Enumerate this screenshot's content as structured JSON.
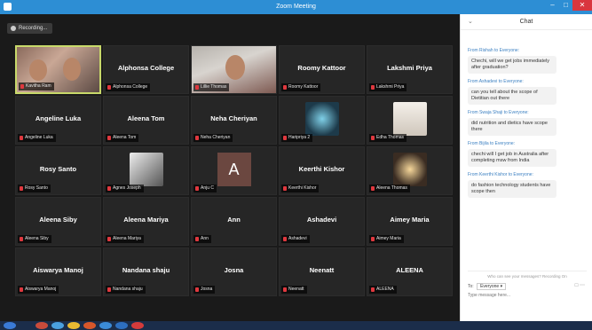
{
  "window": {
    "title": "Zoom Meeting"
  },
  "recording": {
    "label": "Recording..."
  },
  "participants": [
    {
      "name": "Kavitha Ram",
      "display": "",
      "type": "video"
    },
    {
      "name": "Alphonsa College",
      "display": "Alphonsa College",
      "type": "name"
    },
    {
      "name": "Lillie Thomas",
      "display": "",
      "type": "video"
    },
    {
      "name": "Roomy Kattoor",
      "display": "Roomy Kattoor",
      "type": "name"
    },
    {
      "name": "Lakshmi Priya",
      "display": "Lakshmi Priya",
      "type": "name"
    },
    {
      "name": "Angeline Luka",
      "display": "Angeline Luka",
      "type": "name"
    },
    {
      "name": "Aleena Tom",
      "display": "Aleena Tom",
      "type": "name"
    },
    {
      "name": "Neha Cheriyan",
      "display": "Neha Cheriyan",
      "type": "name"
    },
    {
      "name": "Haripriya 2",
      "display": "",
      "type": "image"
    },
    {
      "name": "Edha Thomas",
      "display": "",
      "type": "image"
    },
    {
      "name": "Rosy Santo",
      "display": "Rosy Santo",
      "type": "name"
    },
    {
      "name": "Agnes Joseph",
      "display": "",
      "type": "image"
    },
    {
      "name": "Anju C",
      "display": "A",
      "type": "avatar"
    },
    {
      "name": "Keerthi Kishor",
      "display": "Keerthi Kishor",
      "type": "name"
    },
    {
      "name": "Aleena Thomas",
      "display": "",
      "type": "image"
    },
    {
      "name": "Aleena Siby",
      "display": "Aleena Siby",
      "type": "name"
    },
    {
      "name": "Aleena Mariya",
      "display": "Aleena Mariya",
      "type": "name"
    },
    {
      "name": "Ann",
      "display": "Ann",
      "type": "name"
    },
    {
      "name": "Ashadevi",
      "display": "Ashadevi",
      "type": "name"
    },
    {
      "name": "Aimey Maria",
      "display": "Aimey Maria",
      "type": "name"
    },
    {
      "name": "Aiswarya Manoj",
      "display": "Aiswarya Manoj",
      "type": "name"
    },
    {
      "name": "Nandana shaju",
      "display": "Nandana shaju",
      "type": "name"
    },
    {
      "name": "Josna",
      "display": "Josna",
      "type": "name"
    },
    {
      "name": "Neenatt",
      "display": "Neenatt",
      "type": "name"
    },
    {
      "name": "ALEENA",
      "display": "ALEENA",
      "type": "name"
    }
  ],
  "chat": {
    "title": "Chat",
    "messages": [
      {
        "from": "From Rishah to Everyone:",
        "text": "Chechi, will we get jobs immediately after graduation?"
      },
      {
        "from": "From Ashadevi to Everyone:",
        "text": "can you tell about the scope of Dietitian out there"
      },
      {
        "from": "From Swaja Shaji to Everyone:",
        "text": "did nutrition and dietics have scope there"
      },
      {
        "from": "From Bijila to Everyone:",
        "text": "chechi will I get job in Australia after completing msw from India"
      },
      {
        "from": "From Keerthi Kishor to Everyone:",
        "text": "do fashion technology students have scope then"
      }
    ],
    "hint": "Who can see your messages? Recording On",
    "to_label": "To:",
    "to_value": "Everyone",
    "input_placeholder": "Type message here..."
  },
  "colors": {
    "titlebar": "#2d8ed4",
    "active_speaker": "#c8d96a",
    "mic_muted": "#e0383e",
    "chat_from": "#3a7fc1"
  }
}
